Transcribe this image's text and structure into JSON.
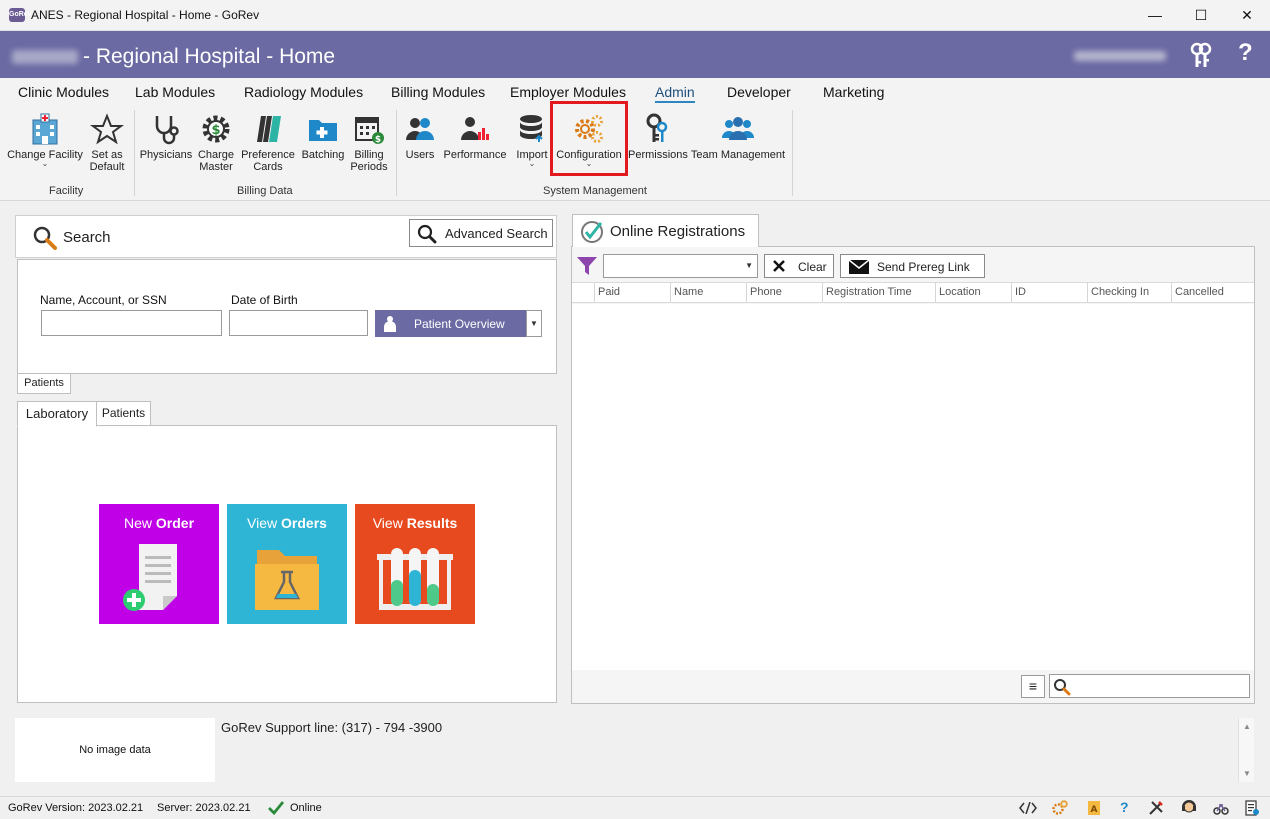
{
  "window": {
    "title": "ANES - Regional Hospital - Home - GoRev",
    "app_icon_text": "GoRev",
    "minimize": "—",
    "maximize": "☐",
    "close": "✕"
  },
  "header": {
    "title": "- Regional Hospital - Home",
    "help": "?"
  },
  "ribbon": {
    "tabs": [
      "Clinic Modules",
      "Lab Modules",
      "Radiology Modules",
      "Billing Modules",
      "Employer Modules",
      "Admin",
      "Developer",
      "Marketing"
    ],
    "active_tab": "Admin",
    "buttons": {
      "change_facility": "Change Facility",
      "set_as_default": "Set as Default",
      "physicians": "Physicians",
      "charge_master": "Charge Master",
      "preference_cards": "Preference Cards",
      "batching": "Batching",
      "billing_periods": "Billing Periods",
      "users": "Users",
      "performance": "Performance",
      "import": "Import",
      "configuration": "Configuration",
      "permissions": "Permissions",
      "team_management": "Team Management"
    },
    "groups": {
      "facility": "Facility",
      "billing_data": "Billing Data",
      "system_management": "System Management"
    }
  },
  "search": {
    "title": "Search",
    "advanced_search": "Advanced Search",
    "name_label": "Name, Account, or SSN",
    "dob_label": "Date of Birth",
    "name_value": "",
    "dob_value": "",
    "patient_overview": "Patient Overview",
    "patients_tab": "Patients"
  },
  "lab": {
    "tabs": [
      "Laboratory",
      "Patients"
    ],
    "tiles": {
      "new_order": {
        "prefix": "New ",
        "strong": "Order",
        "color": "#c000e6"
      },
      "view_orders": {
        "prefix": "View ",
        "strong": "Orders",
        "color": "#2eb4d4"
      },
      "view_results": {
        "prefix": "View ",
        "strong": "Results",
        "color": "#e84a1f"
      }
    }
  },
  "registrations": {
    "title": "Online Registrations",
    "filter_value": "",
    "clear": "Clear",
    "send_prereg": "Send Prereg Link",
    "columns": [
      "Paid",
      "Name",
      "Phone",
      "Registration Time",
      "Location",
      "ID",
      "Checking In",
      "Cancelled"
    ],
    "search_value": ""
  },
  "bottom": {
    "no_image": "No image data",
    "support_line": "GoRev Support line: (317) - 794 -3900"
  },
  "status": {
    "version": "GoRev Version: 2023.02.21",
    "server": "Server: 2023.02.21",
    "online": "Online"
  }
}
